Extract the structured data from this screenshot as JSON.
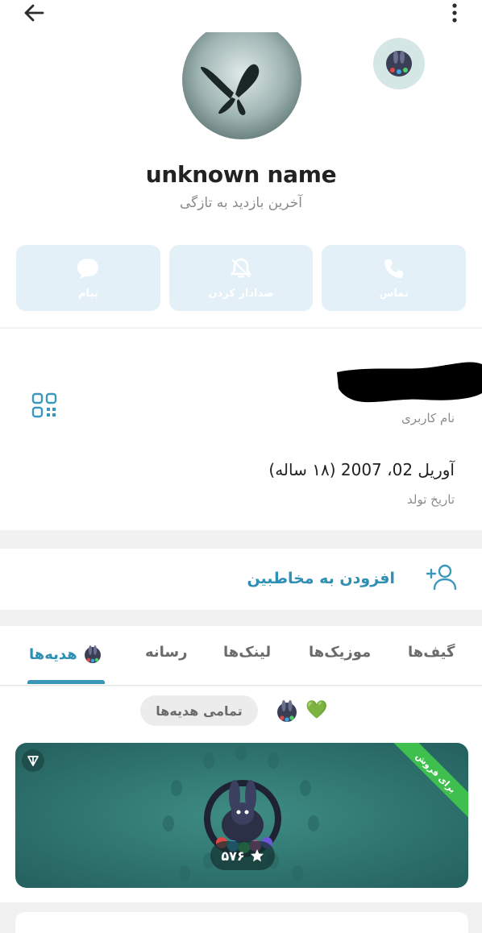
{
  "header": {
    "back_icon": "arrow-left-icon",
    "more_icon": "more-vertical-icon"
  },
  "profile": {
    "name": "unknown name",
    "last_seen": "آخرین بازدید به تازگی"
  },
  "actions": [
    {
      "label": "پیام",
      "icon": "message-icon"
    },
    {
      "label": "صدادار کردن",
      "icon": "bell-off-icon"
    },
    {
      "label": "تماس",
      "icon": "phone-icon"
    }
  ],
  "info": {
    "username_label": "نام کاربری",
    "birthday_value": "آوریل 02، 2007 (۱۸ ساله)",
    "birthday_label": "تاریخ تولد"
  },
  "add_contact": {
    "label": "افزودن به مخاطبین"
  },
  "tabs": [
    "هدیه‌ها",
    "رسانه",
    "لینک‌ها",
    "موزیک‌ها",
    "گیف‌ها"
  ],
  "active_tab": "هدیه‌ها",
  "gifts": {
    "filter_label": "تمامی هدیه‌ها",
    "filter_heart": "💚",
    "card": {
      "ribbon": "برای فروش",
      "price": "۵۷۶"
    }
  },
  "colors": {
    "accent": "#2e8fb4",
    "action_bg": "#e3f0f8",
    "card_bg": "#2f746f",
    "ribbon": "#3fbf4e"
  }
}
